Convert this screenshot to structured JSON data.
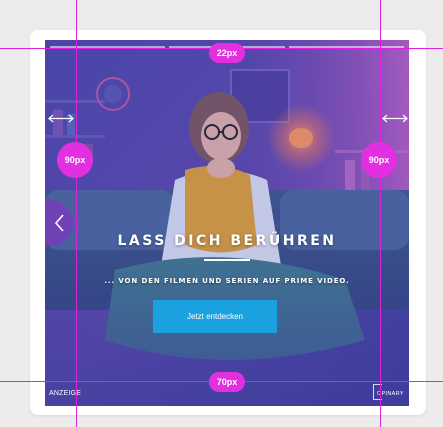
{
  "ad": {
    "headline": "LASS DICH BERÜHREN",
    "subline": "... VON DEN FILMEN UND SERIEN AUF PRIME VIDEO.",
    "cta_label": "Jetzt entdecken",
    "disclosure_label": "ANZEIGE",
    "brand_label": "OPINARY",
    "progress_segments": 3,
    "colors": {
      "overlay": "#6f4fb3",
      "cta": "#1aa1df",
      "guides": "#e020e0"
    }
  },
  "measurements": {
    "top_gap": "22px",
    "left_gap": "90px",
    "right_gap": "90px",
    "bottom_gap": "70px"
  },
  "icons": {
    "prev": "chevron-left-icon",
    "gap_arrow": "double-arrow-icon"
  }
}
